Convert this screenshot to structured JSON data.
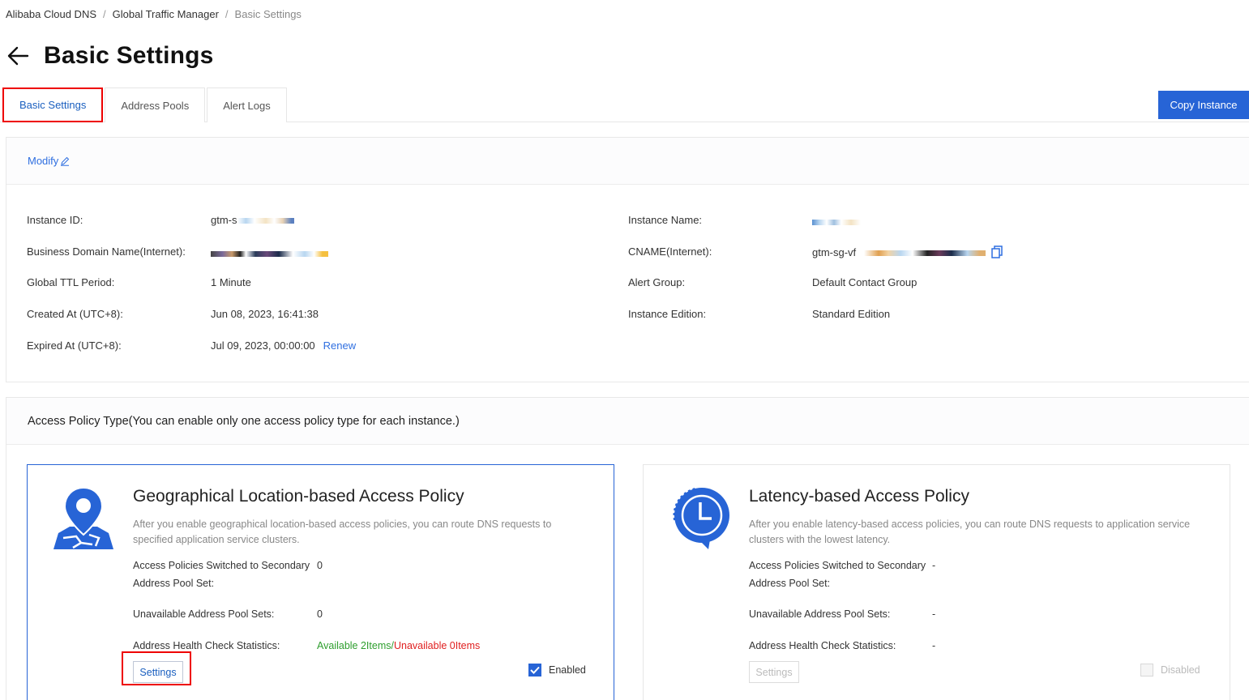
{
  "breadcrumb": {
    "item1": "Alibaba Cloud DNS",
    "item2": "Global Traffic Manager",
    "item3": "Basic Settings",
    "separator": "/"
  },
  "header": {
    "title": "Basic Settings"
  },
  "tabs": [
    {
      "label": "Basic Settings",
      "active": true
    },
    {
      "label": "Address Pools"
    },
    {
      "label": "Alert Logs"
    }
  ],
  "toolbar": {
    "copy_label": "Copy Instance"
  },
  "basic": {
    "modify_label": "Modify",
    "instance_id_label": "Instance ID:",
    "instance_id_value": "gtm-s",
    "business_domain_label": "Business Domain Name(Internet):",
    "ttl_label": "Global TTL Period:",
    "ttl_value": "1 Minute",
    "created_label": "Created At (UTC+8):",
    "created_value": "Jun 08, 2023, 16:41:38",
    "expired_label": "Expired At (UTC+8):",
    "expired_value": "Jul 09, 2023, 00:00:00",
    "renew_label": "Renew",
    "instance_name_label": "Instance Name:",
    "cname_label": "CNAME(Internet):",
    "cname_value": "gtm-sg-vf",
    "alert_group_label": "Alert Group:",
    "alert_group_value": "Default Contact Group",
    "edition_label": "Instance Edition:",
    "edition_value": "Standard Edition"
  },
  "policy": {
    "heading": "Access Policy Type(You can enable only one access policy type for each instance.)",
    "geo": {
      "title": "Geographical Location-based Access Policy",
      "desc": "After you enable geographical location-based access policies, you can route DNS requests to specified application service clusters.",
      "switched_label_1": "Access Policies Switched to Secondary",
      "switched_label_2": "Address Pool Set:",
      "switched_value": "0",
      "unavailable_label": "Unavailable Address Pool Sets:",
      "unavailable_value": "0",
      "health_label": "Address Health Check Statistics:",
      "health_available": "Available 2Items",
      "health_sep": "/",
      "health_unavailable": "Unavailable 0Items",
      "settings_label": "Settings",
      "status_label": "Enabled",
      "icon": "map-pin-icon"
    },
    "latency": {
      "title": "Latency-based Access Policy",
      "desc": "After you enable latency-based access policies, you can route DNS requests to application service clusters with the lowest latency.",
      "switched_label_1": "Access Policies Switched to Secondary",
      "switched_label_2": "Address Pool Set:",
      "switched_value": "-",
      "unavailable_label": "Unavailable Address Pool Sets:",
      "unavailable_value": "-",
      "health_label": "Address Health Check Statistics:",
      "health_value": "-",
      "settings_label": "Settings",
      "status_label": "Disabled",
      "icon": "clock-icon"
    }
  },
  "colors": {
    "primary": "#2764d6",
    "highlight": "#e00000",
    "link": "#2f6fe0",
    "available": "#2e9e2e",
    "unavailable": "#e02020"
  }
}
